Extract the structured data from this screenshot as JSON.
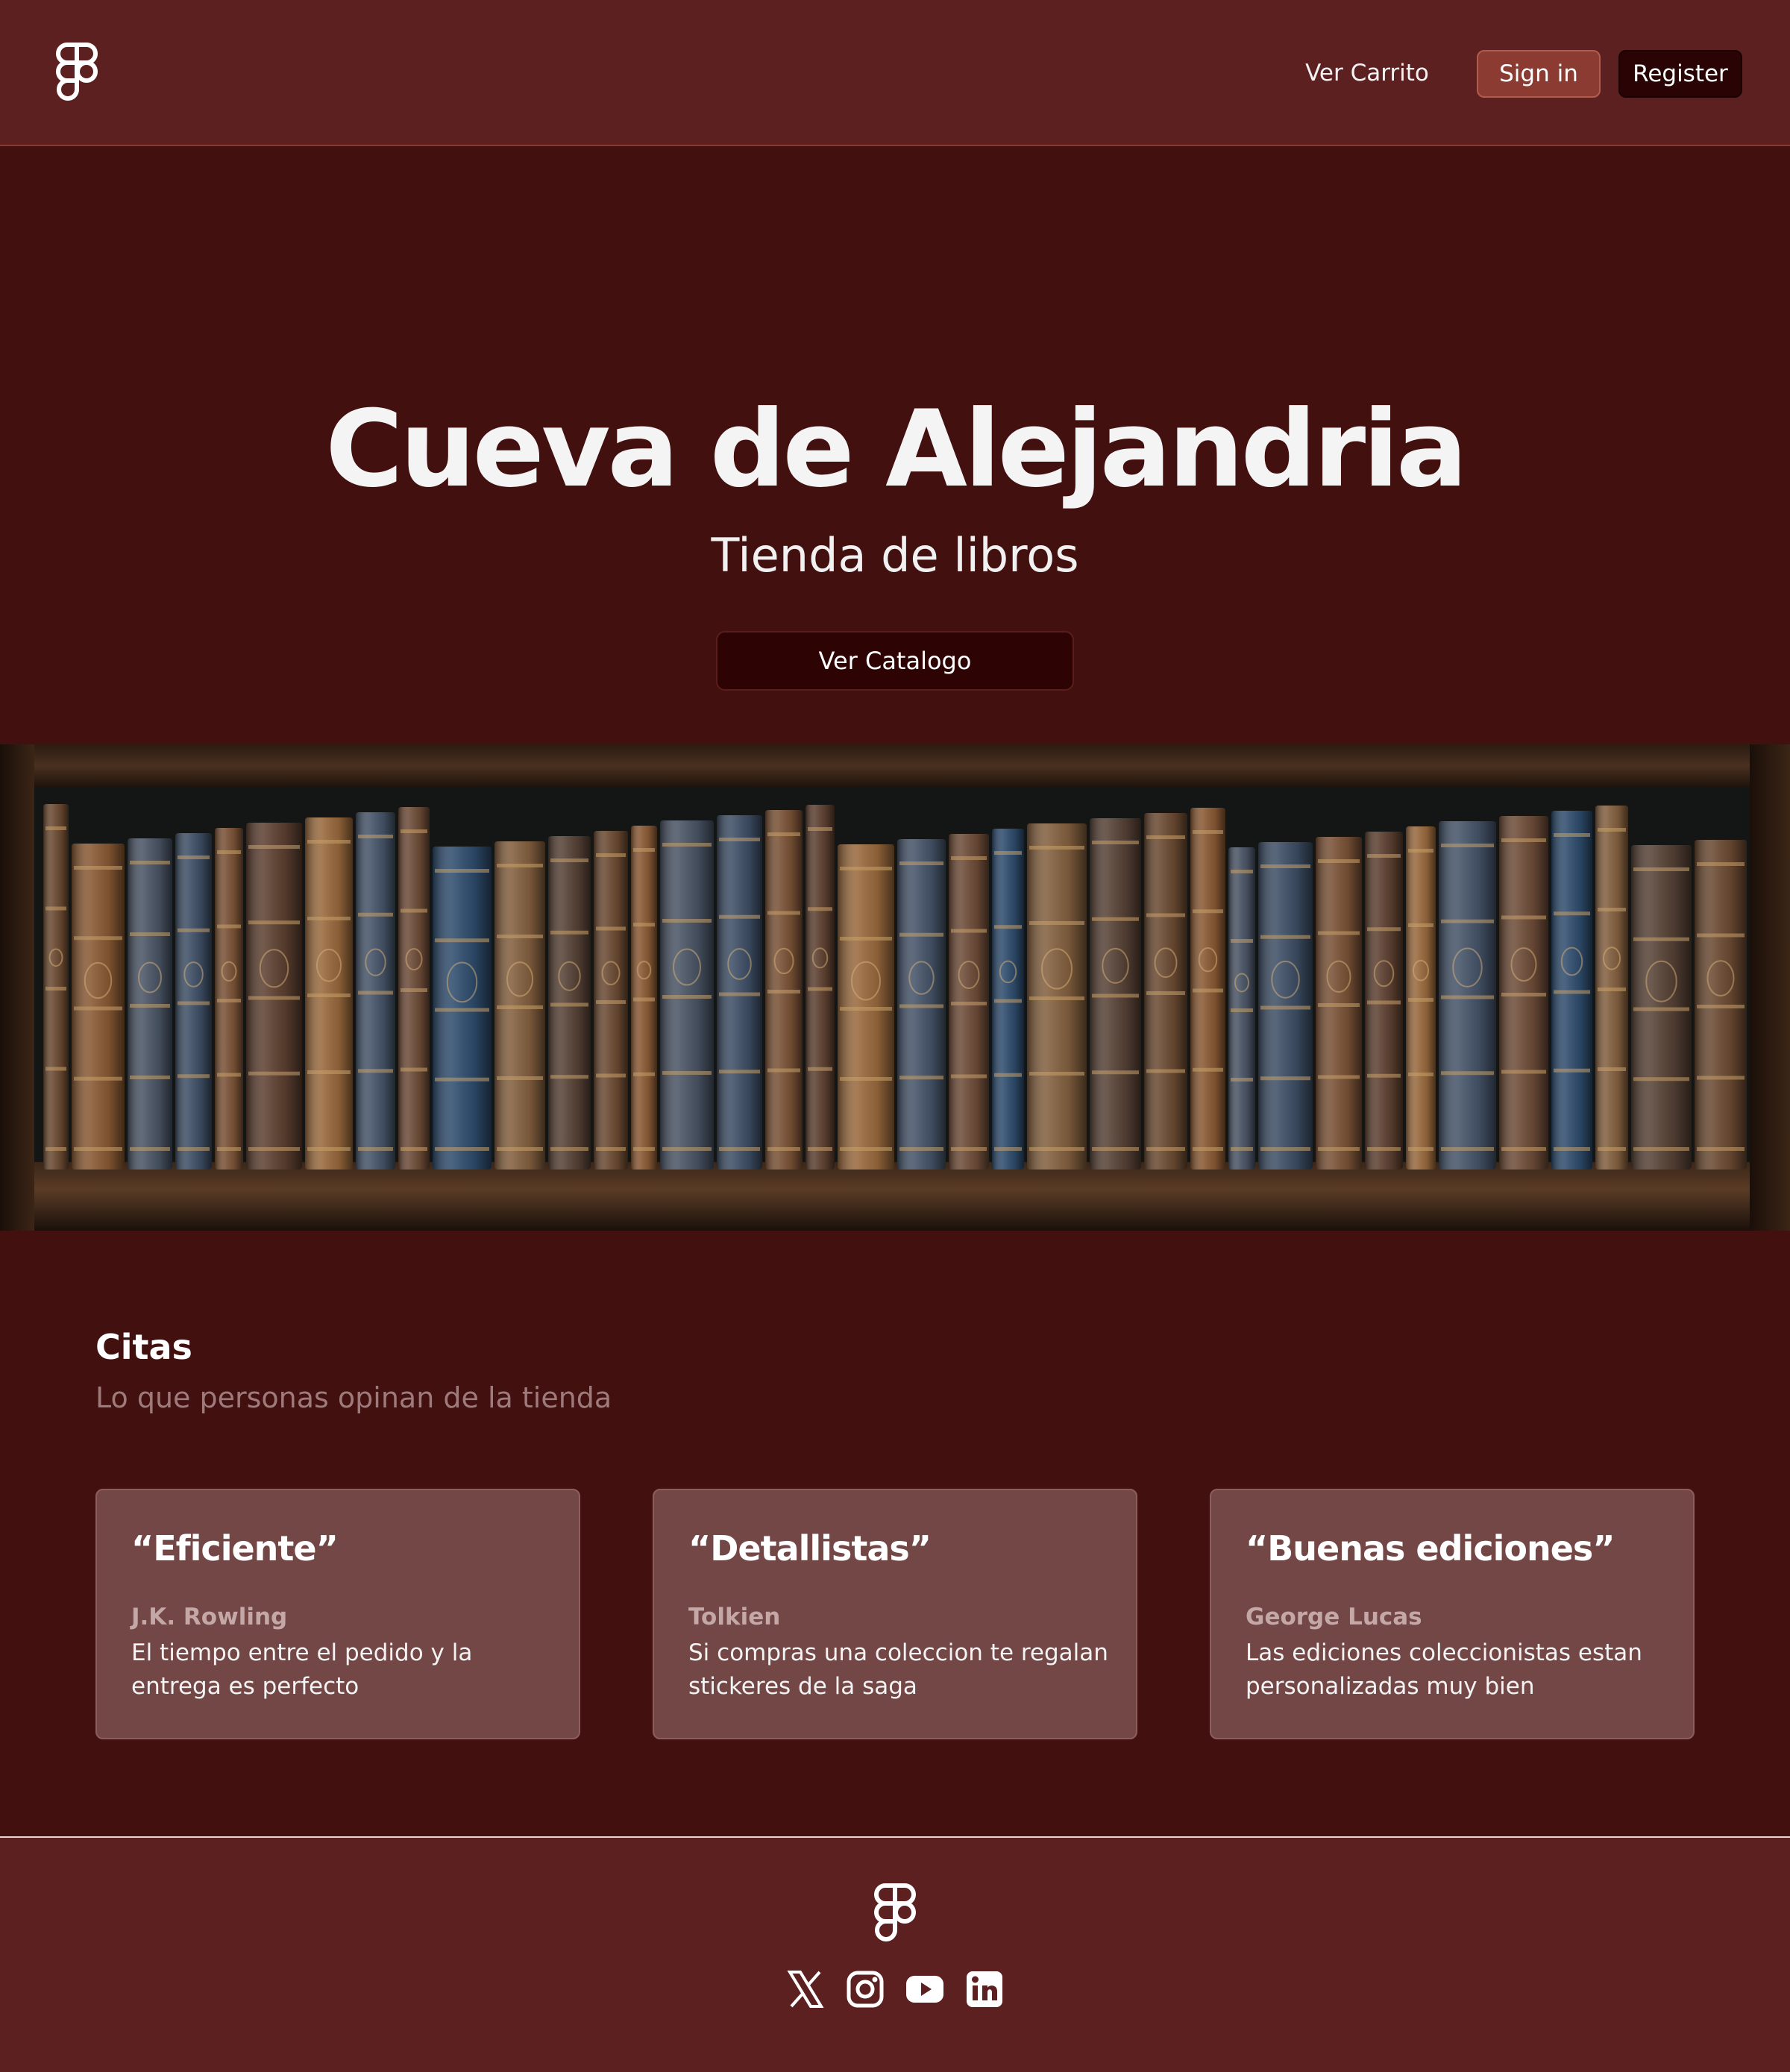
{
  "header": {
    "logo_icon": "figma-logo-icon",
    "cart_link": "Ver Carrito",
    "signin_label": "Sign in",
    "register_label": "Register"
  },
  "hero": {
    "title": "Cueva de Alejandria",
    "subtitle": "Tienda de libros",
    "cta_label": "Ver Catalogo",
    "image": "bookshelf-image"
  },
  "quotes": {
    "title": "Citas",
    "subtitle": "Lo que personas opinan de la tienda",
    "cards": [
      {
        "quote": "“Eficiente”",
        "author": "J.K. Rowling",
        "text": "El tiempo entre el pedido y la entrega es perfecto"
      },
      {
        "quote": "“Detallistas”",
        "author": "Tolkien",
        "text": "Si compras una coleccion te regalan stickeres de la saga"
      },
      {
        "quote": "“Buenas ediciones”",
        "author": "George Lucas",
        "text": "Las ediciones coleccionistas estan personalizadas muy bien"
      }
    ]
  },
  "footer": {
    "logo_icon": "figma-logo-icon",
    "social": [
      "x-icon",
      "instagram-icon",
      "youtube-icon",
      "linkedin-icon"
    ]
  },
  "colors": {
    "header_bg": "#5c2020",
    "page_bg": "#431010",
    "card_bg": "#744747",
    "signin_bg": "#8b3b32",
    "register_bg": "#2a0404"
  }
}
